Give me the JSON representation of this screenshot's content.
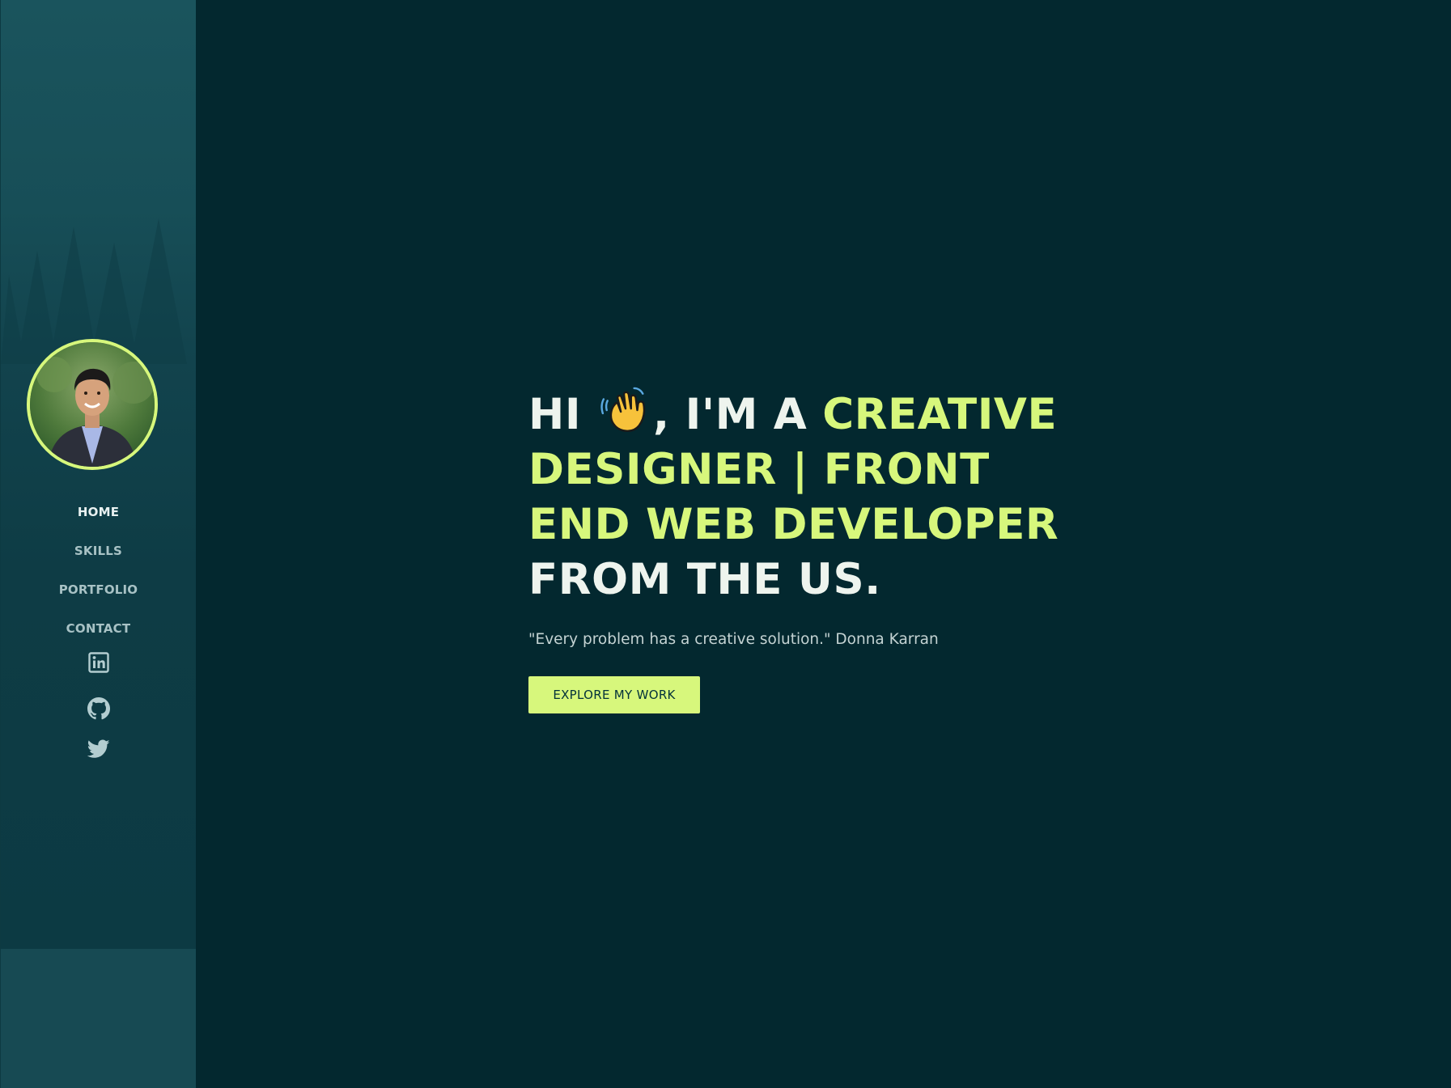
{
  "sidebar": {
    "avatar_alt": "Profile photo",
    "nav": [
      {
        "label": "HOME",
        "active": true
      },
      {
        "label": "SKILLS",
        "active": false
      },
      {
        "label": "PORTFOLIO",
        "active": false
      },
      {
        "label": "CONTACT",
        "active": false
      }
    ],
    "social": [
      {
        "icon": "linkedin-icon"
      },
      {
        "icon": "github-icon"
      },
      {
        "icon": "twitter-icon"
      }
    ]
  },
  "hero": {
    "greeting": "HI",
    "wave_icon": "waving-hand-icon",
    "intro": ", I'M A",
    "role": "CREATIVE DESIGNER | FRONT END WEB DEVELOPER",
    "origin": "FROM THE US.",
    "quote": "\"Every problem has a creative solution.\" Donna Karran",
    "cta_label": "EXPLORE MY WORK"
  },
  "colors": {
    "background": "#03282f",
    "sidebar": "#164a54",
    "accent": "#d7f77c",
    "heading_text": "#eef4ee"
  }
}
